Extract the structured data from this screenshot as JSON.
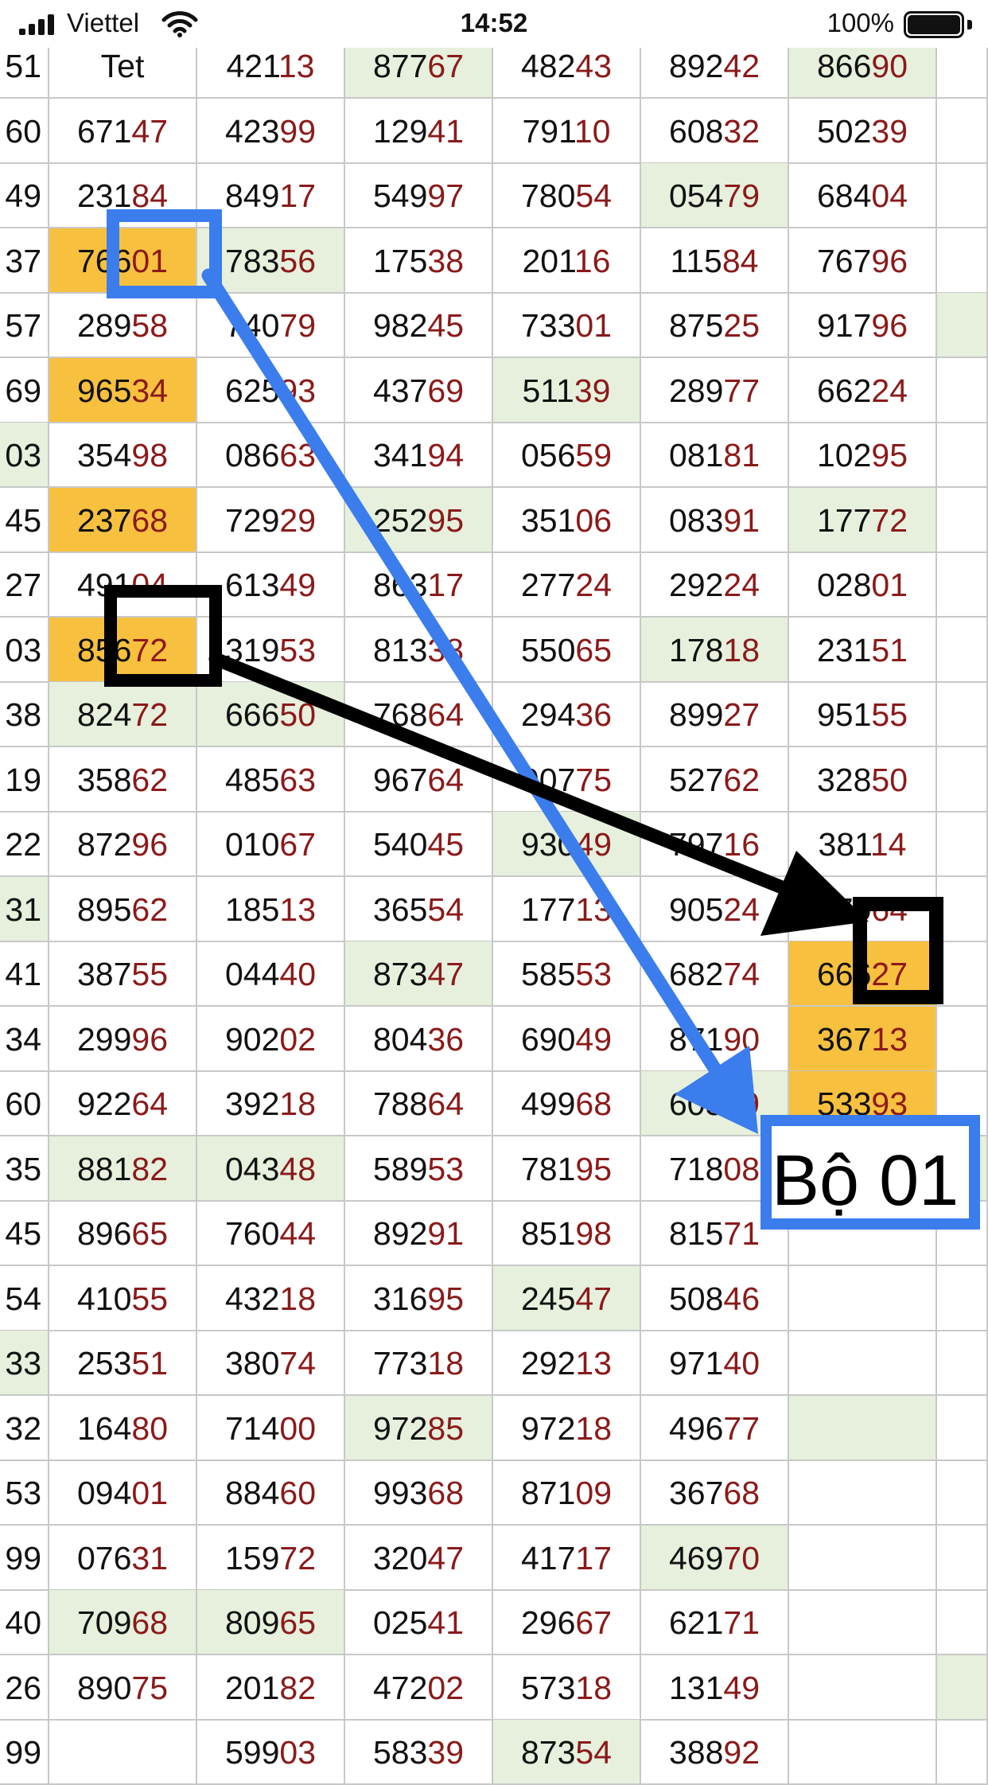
{
  "status_bar": {
    "carrier": "Viettel",
    "time": "14:52",
    "battery": "100%"
  },
  "table": {
    "rows": [
      [
        "51",
        "Tet",
        "42113",
        "87767",
        "48243",
        "89242",
        "86690",
        ""
      ],
      [
        "60",
        "67147",
        "42399",
        "12941",
        "79110",
        "60832",
        "50239",
        ""
      ],
      [
        "49",
        "23184",
        "84917",
        "54997",
        "78054",
        "05479",
        "68404",
        ""
      ],
      [
        "37",
        "76601",
        "78356",
        "17538",
        "20116",
        "11584",
        "76796",
        ""
      ],
      [
        "57",
        "28958",
        "74079",
        "98245",
        "73301",
        "87525",
        "91796",
        ""
      ],
      [
        "69",
        "96534",
        "62593",
        "43769",
        "51139",
        "28977",
        "66224",
        ""
      ],
      [
        "03",
        "35498",
        "08663",
        "34194",
        "05659",
        "08181",
        "10295",
        ""
      ],
      [
        "45",
        "23768",
        "72929",
        "25295",
        "35106",
        "08391",
        "17772",
        ""
      ],
      [
        "27",
        "49104",
        "61349",
        "86317",
        "27724",
        "29224",
        "02801",
        ""
      ],
      [
        "03",
        "85672",
        "31953",
        "81338",
        "55065",
        "17818",
        "23151",
        ""
      ],
      [
        "38",
        "82472",
        "66650",
        "76864",
        "29436",
        "89927",
        "95155",
        ""
      ],
      [
        "19",
        "35862",
        "48563",
        "96764",
        "90775",
        "52762",
        "32850",
        ""
      ],
      [
        "22",
        "87296",
        "01067",
        "54045",
        "93049",
        "79716",
        "38114",
        ""
      ],
      [
        "31",
        "89562",
        "18513",
        "36554",
        "17713",
        "90524",
        "77064",
        ""
      ],
      [
        "41",
        "38755",
        "04440",
        "87347",
        "58553",
        "68274",
        "66627",
        ""
      ],
      [
        "34",
        "29996",
        "90202",
        "80436",
        "69049",
        "87190",
        "36713",
        ""
      ],
      [
        "60",
        "92264",
        "39218",
        "78864",
        "49968",
        "60559",
        "53393",
        ""
      ],
      [
        "35",
        "88182",
        "04348",
        "58953",
        "78195",
        "71808",
        "",
        ""
      ],
      [
        "45",
        "89665",
        "76044",
        "89291",
        "85198",
        "81571",
        "",
        ""
      ],
      [
        "54",
        "41055",
        "43218",
        "31695",
        "24547",
        "50846",
        "",
        ""
      ],
      [
        "33",
        "25351",
        "38074",
        "77318",
        "29213",
        "97140",
        "",
        ""
      ],
      [
        "32",
        "16480",
        "71400",
        "97285",
        "97218",
        "49677",
        "",
        ""
      ],
      [
        "53",
        "09401",
        "88460",
        "99368",
        "87109",
        "36768",
        "",
        ""
      ],
      [
        "99",
        "07631",
        "15972",
        "32047",
        "41717",
        "46970",
        "",
        ""
      ],
      [
        "40",
        "70968",
        "80965",
        "02541",
        "29667",
        "62171",
        "",
        ""
      ],
      [
        "26",
        "89075",
        "20182",
        "47202",
        "57318",
        "13149",
        "",
        ""
      ],
      [
        "99",
        "",
        "59903",
        "58339",
        "87354",
        "38892",
        "",
        ""
      ]
    ],
    "green_cells": [
      "0-3",
      "0-6",
      "2-5",
      "3-2",
      "4-7",
      "5-4",
      "6-0",
      "7-3",
      "7-6",
      "9-5",
      "10-1",
      "10-2",
      "12-4",
      "13-0",
      "14-3",
      "16-5",
      "17-1",
      "17-2",
      "17-7",
      "19-4",
      "20-0",
      "21-3",
      "21-6",
      "23-5",
      "24-1",
      "24-2",
      "25-7",
      "26-4"
    ],
    "orange_cells": [
      "3-1",
      "5-1",
      "7-1",
      "9-1",
      "14-6",
      "15-6",
      "16-6",
      "17-6"
    ],
    "colors": {
      "grid": "#c8c8c8",
      "green": "#e6f0dd",
      "orange": "#f7c03e",
      "digit_tail": "#8b1a1a",
      "annotation_blue": "#3b7ded",
      "annotation_black": "#000000"
    }
  },
  "annotation": {
    "label": "Bộ 01"
  }
}
